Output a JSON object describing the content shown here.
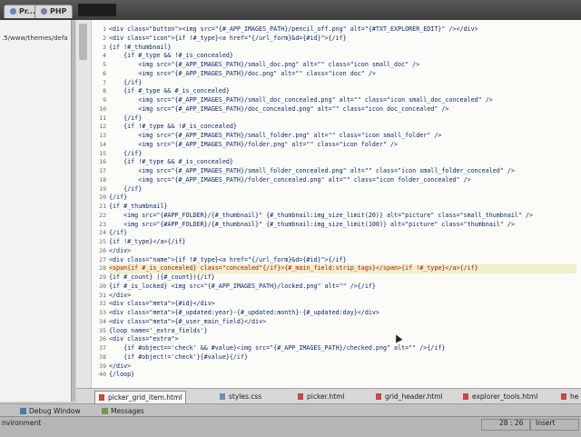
{
  "toolbar": {
    "tab_pr": "Pr...",
    "tab_php": "PHP"
  },
  "sidebar": {
    "path": ".5/www/themes/defa"
  },
  "gutter": [
    "1",
    "2",
    "3",
    "4",
    "5",
    "6",
    "7",
    "8",
    "9",
    "10",
    "11",
    "12",
    "13",
    "14",
    "15",
    "16",
    "17",
    "18",
    "19",
    "20",
    "21",
    "22",
    "23",
    "24",
    "25",
    "26",
    "27",
    "28",
    "29",
    "30",
    "31",
    "32",
    "33",
    "34",
    "35",
    "36",
    "37",
    "38",
    "39",
    "40"
  ],
  "code": [
    "<div class=\"button\"><img src=\"{#_APP_IMAGES_PATH}/pencil_off.png\" alt=\"{#TXT_EXPLORER_EDIT}\" /></div>",
    "<div class=\"icon\">{if !#_type}<a href=\"{/url_form}&d={#id}\">{/if}",
    "{if !#_thumbnail}",
    "    {if #_type && !#_is_concealed}",
    "        <img src=\"{#_APP_IMAGES_PATH}/small_doc.png\" alt=\"\" class=\"icon small_doc\" />",
    "        <img src=\"{#_APP_IMAGES_PATH}/doc.png\" alt=\"\" class=\"icon doc\" />",
    "    {/if}",
    "    {if #_type && #_is_concealed}",
    "        <img src=\"{#_APP_IMAGES_PATH}/small_doc_concealed.png\" alt=\"\" class=\"icon small_doc_concealed\" />",
    "        <img src=\"{#_APP_IMAGES_PATH}/doc_concealed.png\" alt=\"\" class=\"icon doc_concealed\" />",
    "    {/if}",
    "    {if !#_type && !#_is_concealed}",
    "        <img src=\"{#_APP_IMAGES_PATH}/small_folder.png\" alt=\"\" class=\"icon small_folder\" />",
    "        <img src=\"{#_APP_IMAGES_PATH}/folder.png\" alt=\"\" class=\"icon folder\" />",
    "    {/if}",
    "    {if !#_type && #_is_concealed}",
    "        <img src=\"{#_APP_IMAGES_PATH}/small_folder_concealed.png\" alt=\"\" class=\"icon small_folder_concealed\" />",
    "        <img src=\"{#_APP_IMAGES_PATH}/folder_concealed.png\" alt=\"\" class=\"icon folder_concealed\" />",
    "    {/if}",
    "{/if}",
    "{if #_thumbnail}",
    "    <img src=\"{#APP_FOLDER}/{#_thumbnail}\" {#_thumbnail:img_size_limit(20)} alt=\"picture\" class=\"small_thumbnail\" />",
    "    <img src=\"{#APP_FOLDER}/{#_thumbnail}\" {#_thumbnail:img_size_limit(100)} alt=\"picture\" class=\"thumbnail\" />",
    "{/if}",
    "{if !#_type}</a>{/if}",
    "</div>",
    "<div class=\"name\">{if !#_type}<a href=\"{/url_form}&d={#id}\">{/if}",
    "<span{if #_is_concealed} class=\"concealed\"{/if}>{#_main_field:strip_tags}</span>{if !#_type}</a>{/if}",
    "{if #_count} ({#_count}){/if}",
    "{if #_is_locked} <img src=\"{#_APP_IMAGES_PATH}/locked.png\" alt=\"\" />{/if}",
    "</div>",
    "<div class=\"meta\">{#id}</div>",
    "<div class=\"meta\">{#_updated:year}-{#_updated:month}-{#_updated:day}</div>",
    "<div class=\"meta\">{#_user_main_field}</div>",
    "{loop name='_extra_fields'}",
    "<div class=\"extra\">",
    "    {if #object=='check' && #value}<img src=\"{#_APP_IMAGES_PATH}/checked.png\" alt=\"\" />{/if}",
    "    {if #object!='check'}{#value}{/if}",
    "</div>",
    "{/loop}"
  ],
  "file_tabs": [
    "picker_grid_item.html",
    "styles.css",
    "picker.html",
    "grid_header.html",
    "explorer_tools.html",
    "he"
  ],
  "panel_tabs": [
    "Debug Window",
    "Messages"
  ],
  "status": {
    "left": "nvironment",
    "position": "28 : 26",
    "mode": "Insert"
  }
}
